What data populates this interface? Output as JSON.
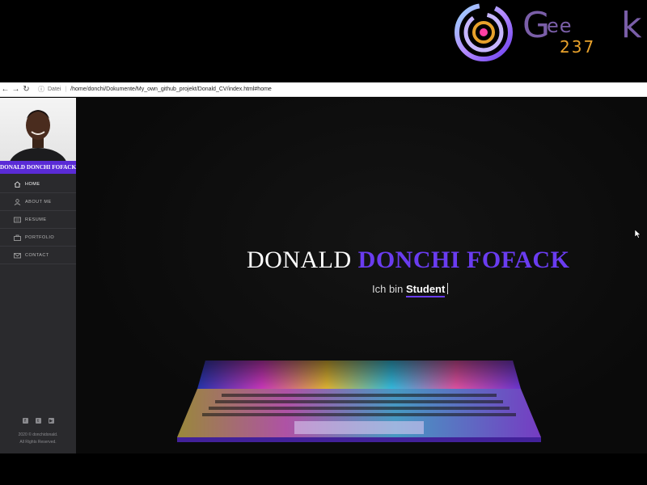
{
  "logo": {
    "g": "G",
    "ee": "ee",
    "num": "237",
    "k": "k"
  },
  "browser": {
    "back_icon": "back-arrow-icon",
    "forward_icon": "forward-arrow-icon",
    "reload_icon": "reload-icon",
    "info_icon": "info-icon",
    "url_label": "Datei",
    "url": "/home/donchi/Dokumente/My_own_github_projekt/Donald_CV/index.html#home"
  },
  "sidebar": {
    "name": "DONALD DONCHI FOFACK",
    "menu": [
      {
        "label": "HOME",
        "icon": "home-icon"
      },
      {
        "label": "ABOUT ME",
        "icon": "user-icon"
      },
      {
        "label": "RESUME",
        "icon": "resume-icon"
      },
      {
        "label": "PORTFOLIO",
        "icon": "briefcase-icon"
      },
      {
        "label": "CONTACT",
        "icon": "envelope-icon"
      }
    ],
    "socials": [
      "facebook-icon",
      "twitter-icon",
      "youtube-icon"
    ],
    "copyright_line1": "2020 © donchidonald.",
    "copyright_line2": "All Rights Reserved."
  },
  "hero": {
    "first_name": "DONALD",
    "last_name": "DONCHI FOFACK",
    "prefix": "Ich bin",
    "role": "Student"
  },
  "colors": {
    "accent": "#6a3cf0",
    "sidebar": "#2a2a2d",
    "logo_purple": "#7a5ea8",
    "logo_orange": "#e8a12b"
  }
}
